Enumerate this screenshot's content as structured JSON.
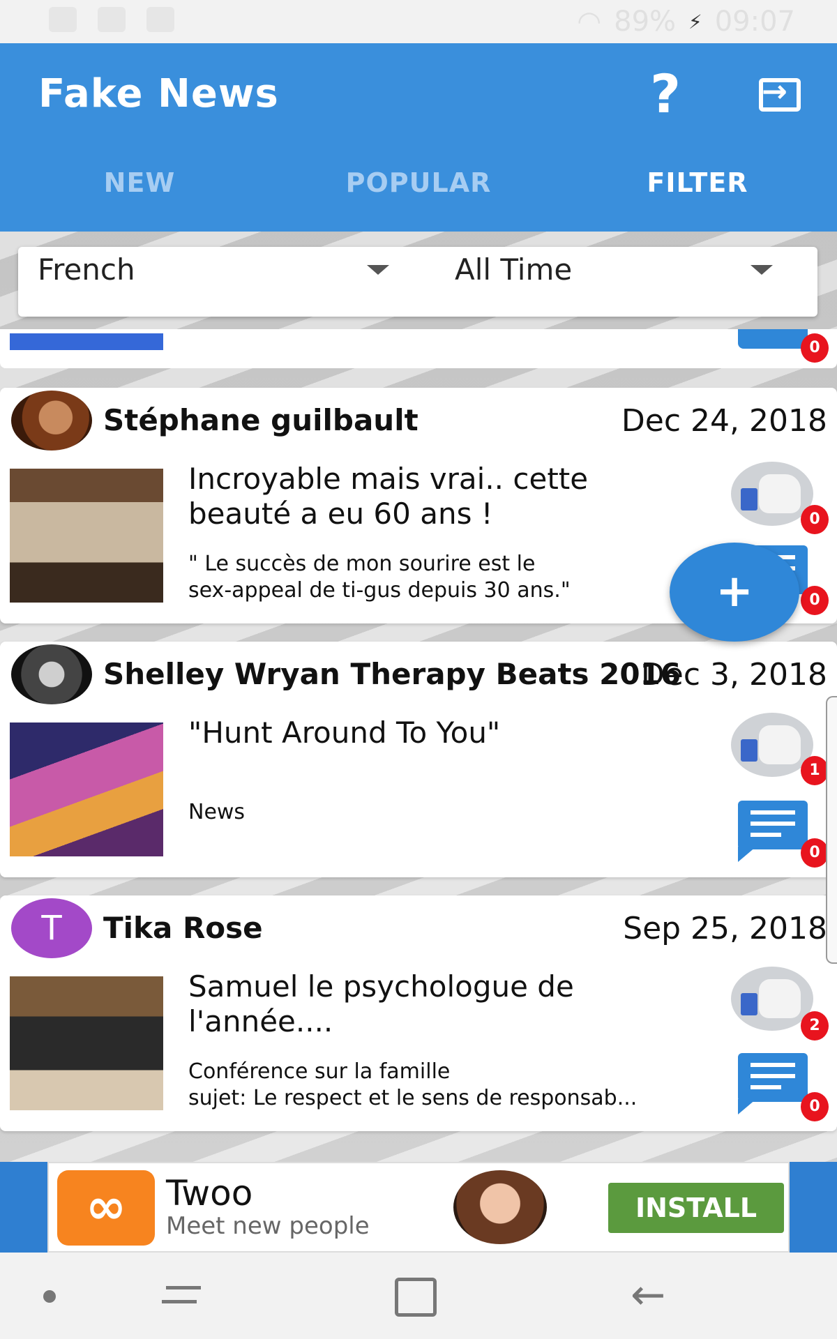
{
  "status_bar": {
    "battery": "89%",
    "time": "09:07"
  },
  "app_bar": {
    "title": "Fake News",
    "help_label": "?",
    "tabs": [
      {
        "label": "NEW",
        "active": false
      },
      {
        "label": "POPULAR",
        "active": false
      },
      {
        "label": "FILTER",
        "active": true
      }
    ]
  },
  "filters": {
    "language": "French",
    "period": "All Time"
  },
  "partial_card": {
    "comment_count": "0"
  },
  "posts": [
    {
      "author": "Stéphane guilbault",
      "date": "Dec 24, 2018",
      "headline": "Incroyable mais vrai.. cette beauté a eu 60 ans !",
      "summary_line1": "\" Le succès de mon sourire est le",
      "summary_line2": "sex-appeal de ti-gus depuis 30 ans.\"",
      "like_count": "0",
      "comment_count": "0"
    },
    {
      "author": "Shelley Wryan Therapy Beats 2016",
      "date": "Dec 3, 2018",
      "headline": "\"Hunt Around To You\"",
      "tag": "News",
      "like_count": "1",
      "comment_count": "0"
    },
    {
      "author": "Tika Rose",
      "avatar_letter": "T",
      "date": "Sep 25, 2018",
      "headline": "Samuel le psychologue de l'année....",
      "summary_line1": "Conférence sur la famille",
      "summary_line2": "sujet: Le respect et le sens de responsab...",
      "like_count": "2",
      "comment_count": "0"
    }
  ],
  "fab_label": "+",
  "ad": {
    "app_name": "Twoo",
    "tagline": "Meet new people",
    "cta": "INSTALL"
  },
  "colors": {
    "primary": "#3a8fdc",
    "accent": "#2f87d8",
    "badge": "#e8141e",
    "install": "#5b9a3e"
  }
}
